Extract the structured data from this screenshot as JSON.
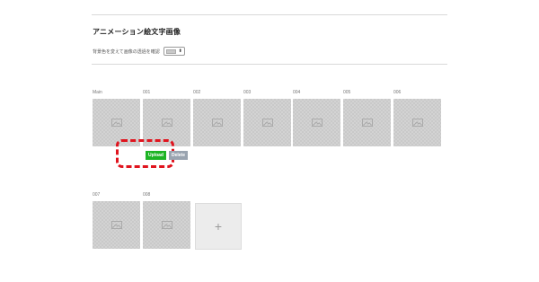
{
  "section": {
    "title": "アニメーション絵文字画像",
    "bg_check_label": "背景色を変えて画像の透過を確認"
  },
  "row1": [
    {
      "label": "Main"
    },
    {
      "label": "001"
    },
    {
      "label": "002"
    },
    {
      "label": "003"
    },
    {
      "label": "004"
    },
    {
      "label": "005"
    },
    {
      "label": "006"
    }
  ],
  "row2": [
    {
      "label": "007"
    },
    {
      "label": "008"
    }
  ],
  "buttons": {
    "upload": "Upload",
    "delete": "Delete"
  },
  "add_symbol": "+",
  "select_arrows": "⬍",
  "icons": {
    "thumbnail": "image-placeholder-icon",
    "add": "plus-icon"
  },
  "colors": {
    "upload_button": "#1db424",
    "delete_button": "#9aa4b0",
    "highlight_dashed": "#e0141e"
  }
}
